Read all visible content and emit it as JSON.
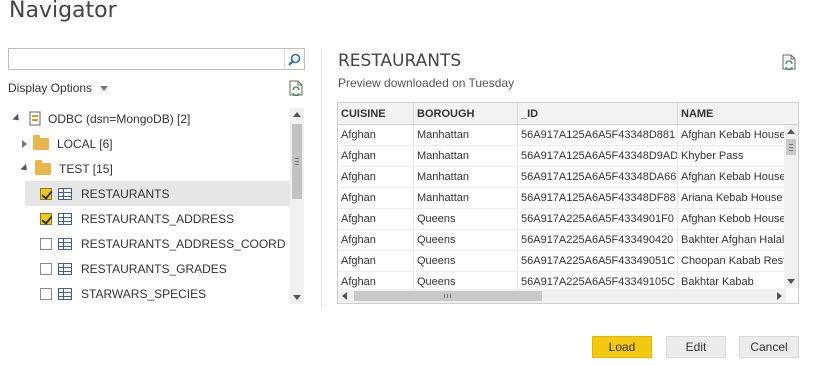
{
  "window": {
    "title": "Navigator"
  },
  "search": {
    "placeholder": "",
    "value": ""
  },
  "display_options": {
    "label": "Display Options"
  },
  "tree": {
    "root": {
      "label": "ODBC (dsn=MongoDB) [2]"
    },
    "folders": [
      {
        "label": "LOCAL [6]",
        "expanded": false
      },
      {
        "label": "TEST [15]",
        "expanded": true
      }
    ],
    "tables": [
      {
        "label": "RESTAURANTS",
        "checked": true,
        "selected": true
      },
      {
        "label": "RESTAURANTS_ADDRESS",
        "checked": true,
        "selected": false
      },
      {
        "label": "RESTAURANTS_ADDRESS_COORD",
        "checked": false,
        "selected": false
      },
      {
        "label": "RESTAURANTS_GRADES",
        "checked": false,
        "selected": false
      },
      {
        "label": "STARWARS_SPECIES",
        "checked": false,
        "selected": false
      }
    ]
  },
  "preview": {
    "title": "RESTAURANTS",
    "subtitle": "Preview downloaded on Tuesday",
    "columns": [
      "CUISINE",
      "BOROUGH",
      "_ID",
      "NAME"
    ],
    "rows": [
      [
        "Afghan",
        "Manhattan",
        "56A917A125A6A5F43348D881",
        "Afghan Kebab House"
      ],
      [
        "Afghan",
        "Manhattan",
        "56A917A125A6A5F43348D9AD",
        "Khyber Pass"
      ],
      [
        "Afghan",
        "Manhattan",
        "56A917A125A6A5F43348DA66",
        "Afghan Kebab House"
      ],
      [
        "Afghan",
        "Manhattan",
        "56A917A125A6A5F43348DF88",
        "Ariana Kebab House"
      ],
      [
        "Afghan",
        "Queens",
        "56A917A225A6A5F4334901F0",
        "Afghan Kebob House"
      ],
      [
        "Afghan",
        "Queens",
        "56A917A225A6A5F433490420",
        "Bakhter Afghan Halal"
      ],
      [
        "Afghan",
        "Queens",
        "56A917A225A6A5F43349051C",
        "Choopan Kabab Resta"
      ],
      [
        "Afghan",
        "Queens",
        "56A917A225A6A5F43349105C",
        "Bakhtar Kabab"
      ]
    ]
  },
  "buttons": {
    "load": "Load",
    "edit": "Edit",
    "cancel": "Cancel"
  },
  "colors": {
    "accent": "#f2c811",
    "selected_row": "#e6e6e6"
  }
}
